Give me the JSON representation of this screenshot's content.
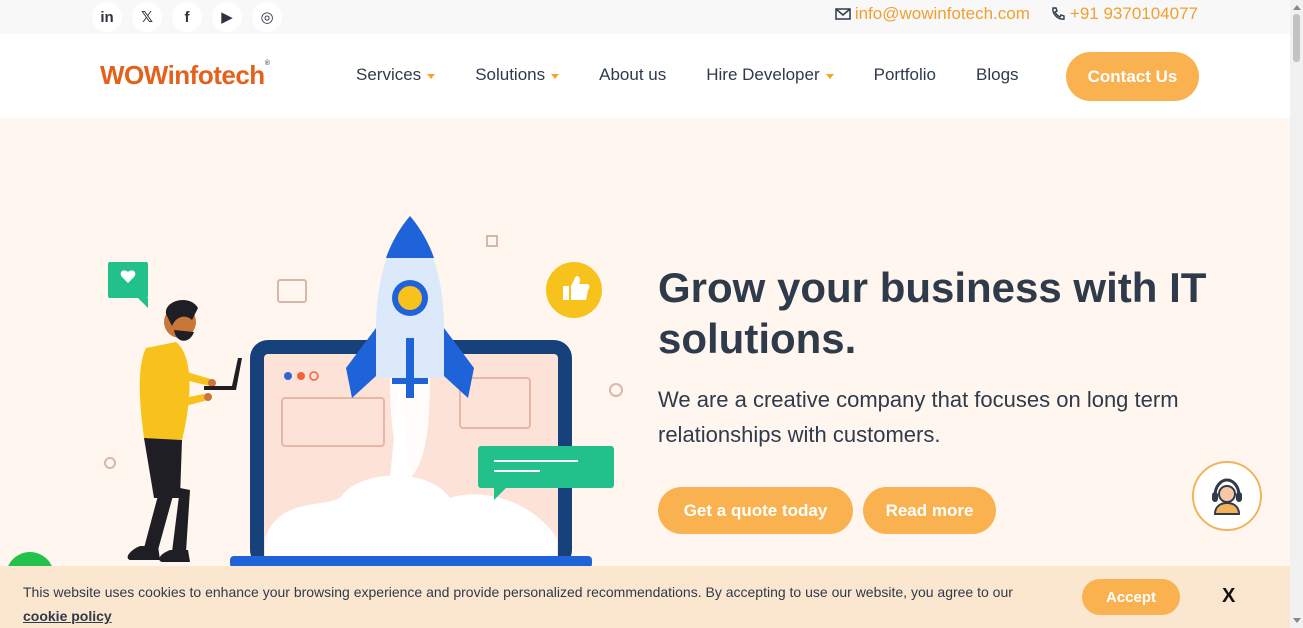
{
  "topbar": {
    "social": [
      {
        "name": "linkedin",
        "glyph": "in"
      },
      {
        "name": "x",
        "glyph": "𝕏"
      },
      {
        "name": "facebook",
        "glyph": "f"
      },
      {
        "name": "youtube",
        "glyph": "▶"
      },
      {
        "name": "instagram",
        "glyph": "◎"
      }
    ],
    "email": "info@wowinfotech.com",
    "phone": "+91 9370104077"
  },
  "nav": {
    "logo": "WOWinfotech",
    "items": [
      {
        "label": "Services",
        "dropdown": true
      },
      {
        "label": "Solutions",
        "dropdown": true
      },
      {
        "label": "About us",
        "dropdown": false
      },
      {
        "label": "Hire Developer",
        "dropdown": true
      },
      {
        "label": "Portfolio",
        "dropdown": false
      },
      {
        "label": "Blogs",
        "dropdown": false
      }
    ],
    "contact_label": "Contact Us"
  },
  "hero": {
    "title": "Grow your business with IT solutions.",
    "subtitle": "We are a creative company that focuses on long term relationships with customers.",
    "quote_label": "Get a quote today",
    "read_label": "Read more"
  },
  "cookie": {
    "text": "This website uses cookies to enhance your browsing experience and provide personalized recommendations. By accepting to use our website, you agree to our",
    "link": "cookie policy",
    "accept_label": "Accept",
    "close_label": "X"
  },
  "colors": {
    "accent": "#f9b24f",
    "brand": "#e4611c",
    "hero_bg": "#fff7ef",
    "text": "#2f3a4b"
  }
}
